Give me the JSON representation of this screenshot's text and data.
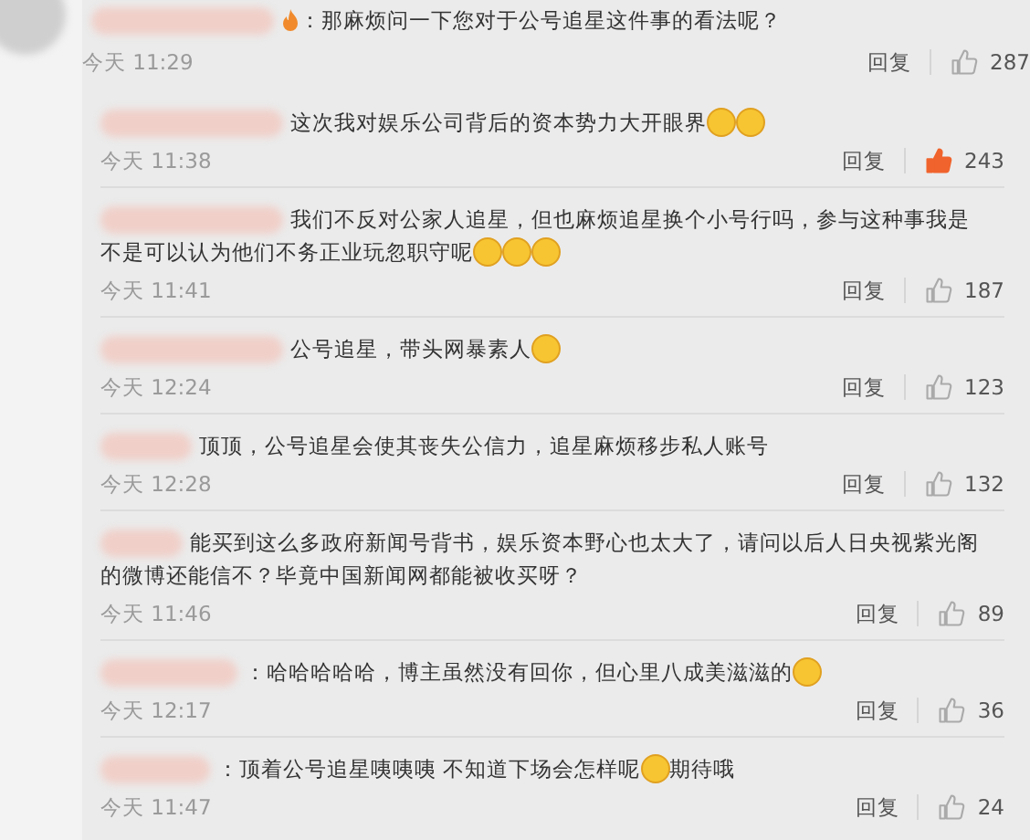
{
  "comment": {
    "lines": [
      [
        {
          "kind": "text",
          "text": "：那麻烦问一下您对于公号追星这件事的看法呢？"
        }
      ]
    ],
    "time": "今天 11:29",
    "reply": "回复",
    "likes": "287",
    "liked": false
  },
  "replies": [
    {
      "lines": [
        [
          {
            "kind": "text",
            "text": "这次我对娱乐公司背后的资本势力大开眼界"
          },
          {
            "kind": "emoji"
          },
          {
            "kind": "emoji"
          }
        ]
      ],
      "time": "今天 11:38",
      "reply": "回复",
      "likes": "243",
      "liked": true
    },
    {
      "lines": [
        [
          {
            "kind": "text",
            "text": "我们不反对公家人追星，但也麻烦追星换个小号行吗，参与这种事我是"
          }
        ],
        [
          {
            "kind": "text",
            "text": "不是可以认为他们不务正业玩忽职守呢"
          },
          {
            "kind": "emoji"
          },
          {
            "kind": "emoji"
          },
          {
            "kind": "emoji"
          }
        ]
      ],
      "time": "今天 11:41",
      "reply": "回复",
      "likes": "187",
      "liked": false
    },
    {
      "lines": [
        [
          {
            "kind": "text",
            "text": "公号追星，带头网暴素人"
          },
          {
            "kind": "emoji"
          }
        ]
      ],
      "time": "今天 12:24",
      "reply": "回复",
      "likes": "123",
      "liked": false
    },
    {
      "lines": [
        [
          {
            "kind": "text",
            "text": "顶顶，公号追星会使其丧失公信力，追星麻烦移步私人账号"
          }
        ]
      ],
      "time": "今天 12:28",
      "reply": "回复",
      "likes": "132",
      "liked": false
    },
    {
      "lines": [
        [
          {
            "kind": "text",
            "text": "能买到这么多政府新闻号背书，娱乐资本野心也太大了，请问以后人日央视紫光阁"
          }
        ],
        [
          {
            "kind": "text",
            "text": "的微博还能信不？毕竟中国新闻网都能被收买呀？"
          }
        ]
      ],
      "time": "今天 11:46",
      "reply": "回复",
      "likes": "89",
      "liked": false
    },
    {
      "lines": [
        [
          {
            "kind": "text",
            "text": "：哈哈哈哈哈，博主虽然没有回你，但心里八成美滋滋的"
          },
          {
            "kind": "emoji"
          }
        ]
      ],
      "time": "今天 12:17",
      "reply": "回复",
      "likes": "36",
      "liked": false
    },
    {
      "lines": [
        [
          {
            "kind": "text",
            "text": "：顶着公号追星咦咦咦 不知道下场会怎样呢"
          },
          {
            "kind": "emoji"
          },
          {
            "kind": "text",
            "text": "期待哦"
          }
        ]
      ],
      "time": "今天 11:47",
      "reply": "回复",
      "likes": "24",
      "liked": false
    }
  ]
}
